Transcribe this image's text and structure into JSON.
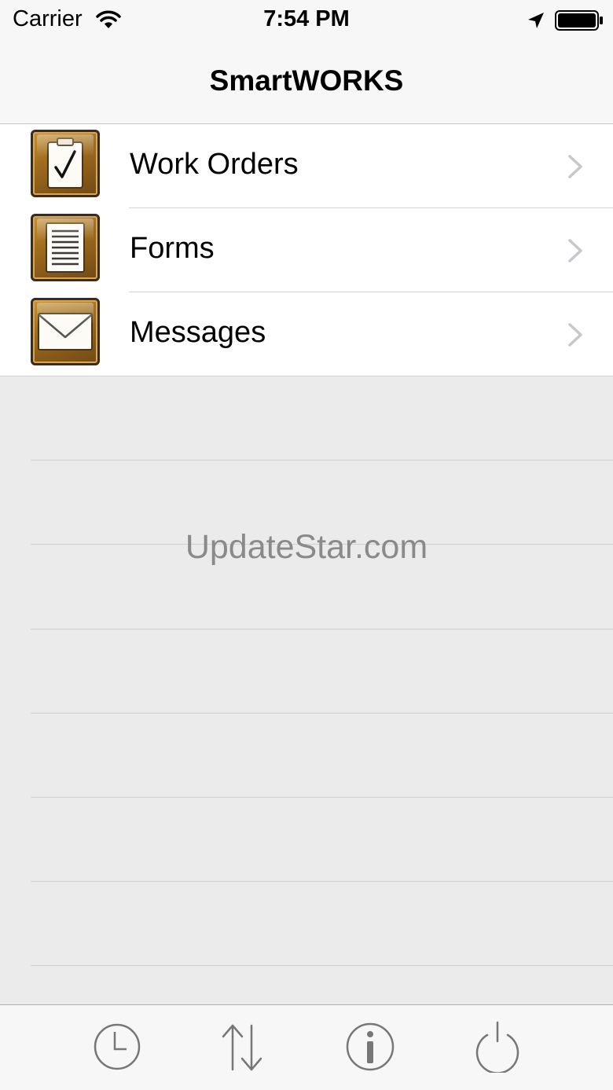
{
  "status_bar": {
    "carrier": "Carrier",
    "time": "7:54 PM",
    "icons": [
      "wifi-icon",
      "location-icon",
      "battery-icon"
    ]
  },
  "nav": {
    "title": "SmartWORKS"
  },
  "menu": {
    "items": [
      {
        "label": "Work Orders",
        "icon": "clipboard-check-icon"
      },
      {
        "label": "Forms",
        "icon": "document-lines-icon"
      },
      {
        "label": "Messages",
        "icon": "envelope-icon"
      }
    ]
  },
  "watermark": "UpdateStar.com",
  "toolbar": {
    "buttons": [
      {
        "icon": "clock-icon"
      },
      {
        "icon": "sync-arrows-icon"
      },
      {
        "icon": "info-icon"
      },
      {
        "icon": "power-icon"
      }
    ]
  },
  "colors": {
    "accent_gold": "#b07d2c",
    "bar_bg": "#f7f7f7",
    "background": "#ebebeb",
    "chevron": "#c7c7cc",
    "toolbar_icon": "#777777"
  }
}
